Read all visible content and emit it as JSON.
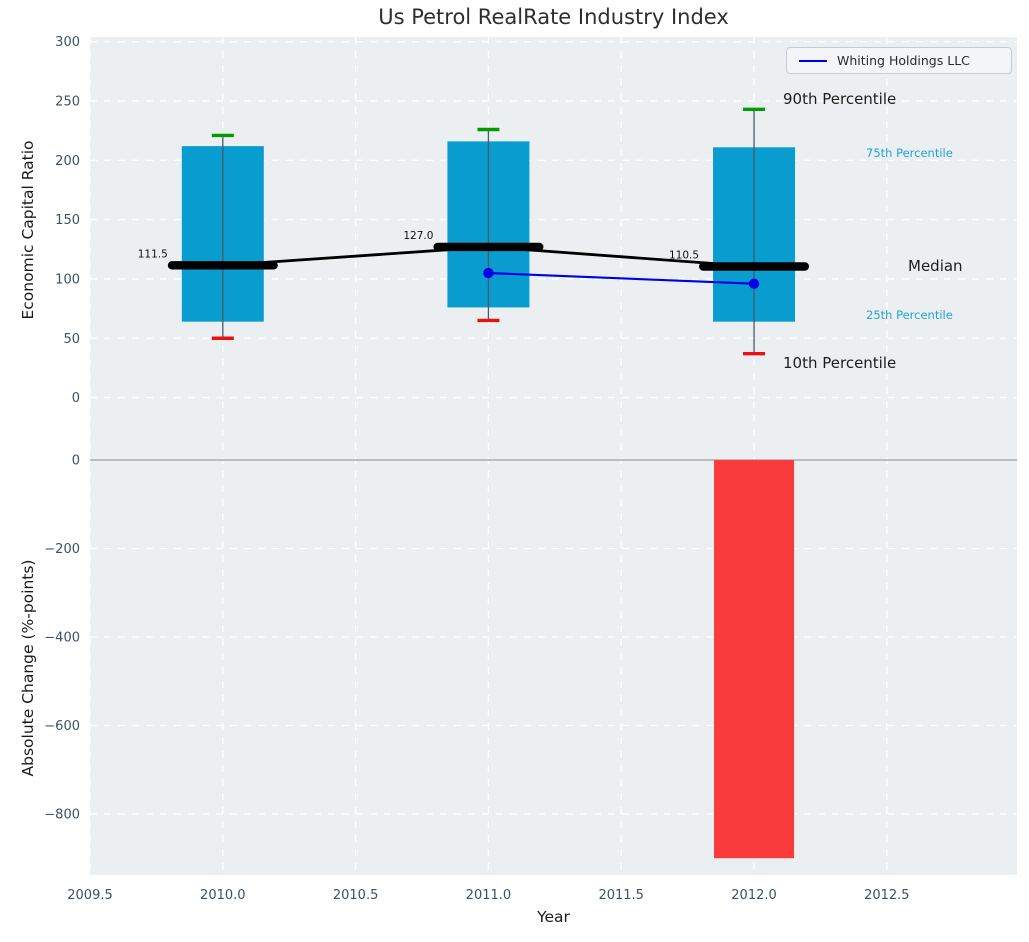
{
  "title": "Us Petrol RealRate Industry Index",
  "legend": {
    "label": "Whiting Holdings LLC"
  },
  "colors": {
    "plot_bg": "#eceff1",
    "grid": "#ffffff",
    "box_fill": "#089ccf",
    "whisker": "#4a5a66",
    "cap_high": "#029b02",
    "cap_low": "#e81010",
    "median_line": "#000000",
    "company_line": "#0000e6",
    "bar_negative": "#fa3b3b",
    "zero_line": "#bcbcbc",
    "tick_text": "#3d5166",
    "cyan_label": "#22a3d4",
    "annotation_text": "#111111"
  },
  "chart_data": [
    {
      "type": "box",
      "title": "Us Petrol RealRate Industry Index",
      "xlabel": "Year",
      "ylabel": "Economic Capital Ratio",
      "categories": [
        2010,
        2011,
        2012
      ],
      "box_stats": [
        {
          "year": 2010,
          "p10": 50,
          "p25": 64,
          "median": 111.5,
          "p75": 212,
          "p90": 221
        },
        {
          "year": 2011,
          "p10": 65,
          "p25": 76,
          "median": 127.0,
          "p75": 216,
          "p90": 226
        },
        {
          "year": 2012,
          "p10": 37,
          "p25": 64,
          "median": 110.5,
          "p75": 211,
          "p90": 243
        }
      ],
      "median_annotations": [
        "111.5",
        "127.0",
        "110.5"
      ],
      "series": [
        {
          "name": "Whiting Holdings LLC",
          "x": [
            2011,
            2012
          ],
          "values": [
            105,
            96
          ]
        }
      ],
      "side_labels": {
        "p90": "90th Percentile",
        "p75": "75th Percentile",
        "median": "Median",
        "p25": "25th Percentile",
        "p10": "10th Percentile"
      },
      "xticks": [
        2009.5,
        2010.0,
        2010.5,
        2011.0,
        2011.5,
        2012.0,
        2012.5
      ],
      "xtick_labels": [
        "2009.5",
        "2010.0",
        "2010.5",
        "2011.0",
        "2011.5",
        "2012.0",
        "2012.5"
      ],
      "yticks": [
        0,
        50,
        100,
        150,
        200,
        250,
        300
      ],
      "ytick_labels": [
        "0",
        "50",
        "100",
        "150",
        "200",
        "250",
        "300"
      ],
      "xlim": [
        2009.5,
        2012.99
      ],
      "ylim": [
        -40,
        304
      ],
      "grid": true,
      "legend_position": "upper right"
    },
    {
      "type": "bar",
      "xlabel": "Year",
      "ylabel": "Absolute Change (%-points)",
      "categories": [
        2012
      ],
      "values": [
        -900
      ],
      "yticks": [
        0,
        -200,
        -400,
        -600,
        -800
      ],
      "ytick_labels": [
        "0",
        "−200",
        "−400",
        "−600",
        "−800"
      ],
      "ylim": [
        -938,
        34
      ],
      "grid": true
    }
  ]
}
